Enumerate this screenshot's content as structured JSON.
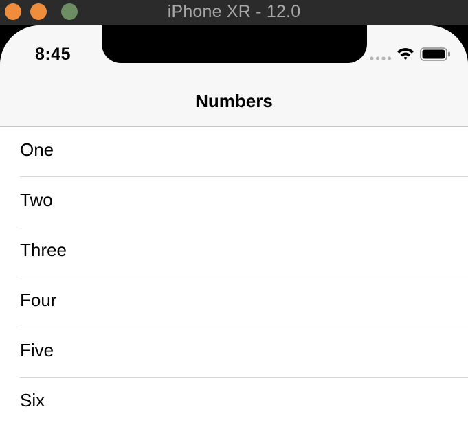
{
  "window": {
    "title": "iPhone XR - 12.0"
  },
  "status_bar": {
    "time": "8:45"
  },
  "nav_bar": {
    "title": "Numbers"
  },
  "table": {
    "rows": [
      {
        "label": "One"
      },
      {
        "label": "Two"
      },
      {
        "label": "Three"
      },
      {
        "label": "Four"
      },
      {
        "label": "Five"
      },
      {
        "label": "Six"
      }
    ]
  },
  "colors": {
    "titlebar_bg": "#2b2b2b",
    "traffic_orange": "#f08d3c",
    "traffic_green": "#6c8e62",
    "nav_bg": "#f7f7f7",
    "separator": "#d6d6da"
  }
}
